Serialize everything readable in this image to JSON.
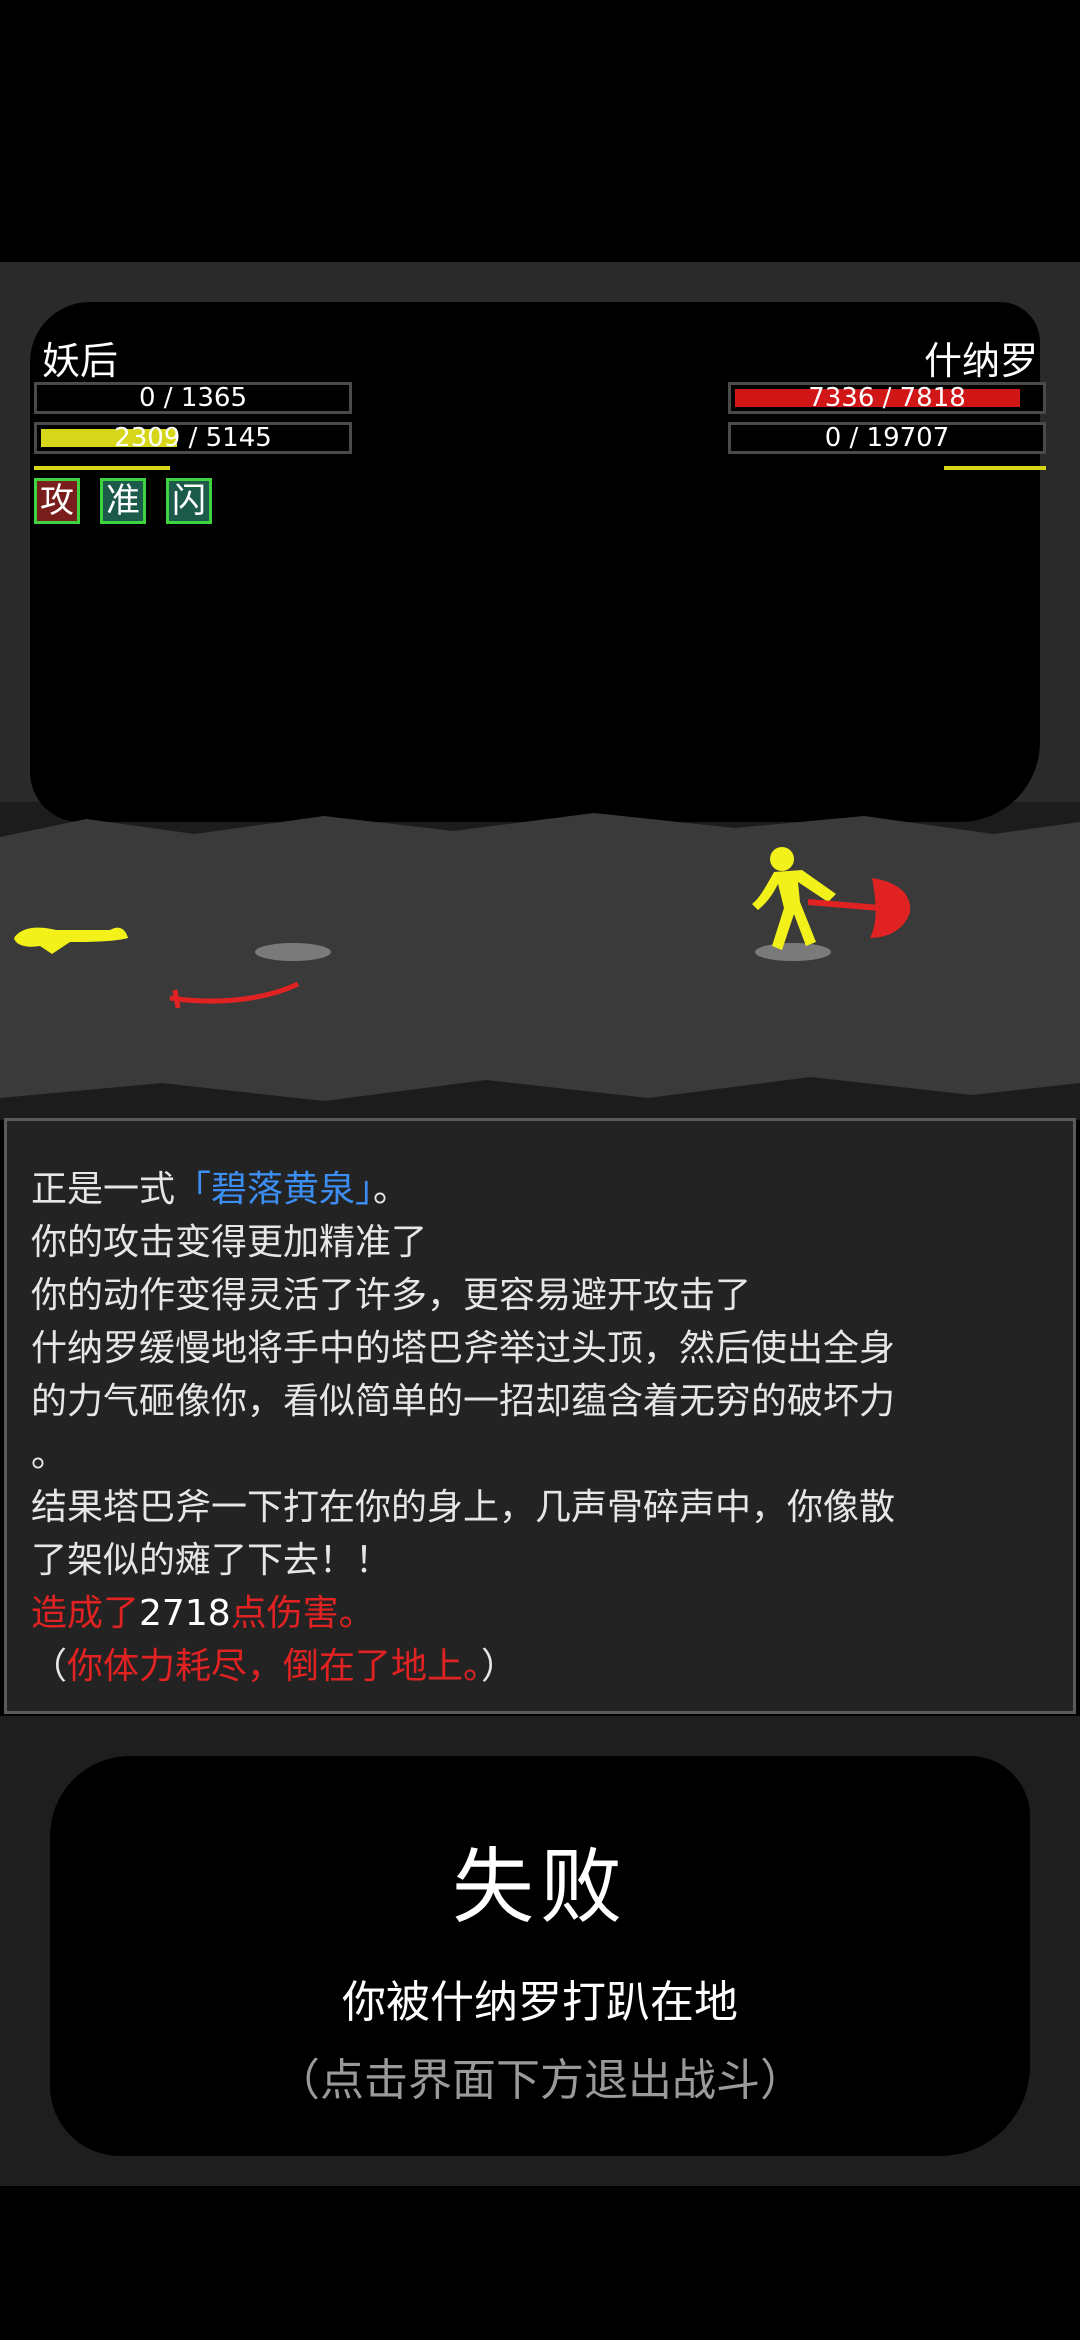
{
  "player": {
    "name": "妖后",
    "hp_text": "0 / 1365",
    "hp_fraction": 0.0,
    "mp_value": "2309",
    "mp_rest": " / 5145",
    "mp_fraction": 0.449,
    "status_buttons": [
      "攻",
      "准",
      "闪"
    ]
  },
  "enemy": {
    "name": "什纳罗",
    "hp_text": "7336 / 7818",
    "hp_fraction": 0.938,
    "mp_text": "0 / 19707",
    "mp_fraction": 0.0
  },
  "colors": {
    "hp_player": "#8a8a8a",
    "hp_enemy": "#d01616",
    "mp_player": "#d6d61a",
    "character": "#f2f21a",
    "weapon": "#e02222",
    "skill_name": "#3d8ef2",
    "damage": "#e02222"
  },
  "log": {
    "line1_prefix": "正是一式",
    "line1_skill": "「碧落黄泉」",
    "line1_suffix": "。",
    "line2": "你的攻击变得更加精准了",
    "line3": "你的动作变得灵活了许多，更容易避开攻击了",
    "line4": "什纳罗缓慢地将手中的塔巴斧举过头顶，然后使出全身",
    "line5": "的力气砸像你，看似简单的一招却蕴含着无穷的破坏力",
    "line6": "。",
    "line7": "结果塔巴斧一下打在你的身上，几声骨碎声中，你像散",
    "line8": "了架似的瘫了下去！！",
    "line9_prefix": "造成了",
    "line9_damage": "2718",
    "line9_suffix": "点伤害。",
    "line10_open": "（",
    "line10_text": "你体力耗尽，倒在了地上。",
    "line10_close": "）"
  },
  "result": {
    "title": "失败",
    "description": "你被什纳罗打趴在地",
    "hint": "（点击界面下方退出战斗）"
  }
}
